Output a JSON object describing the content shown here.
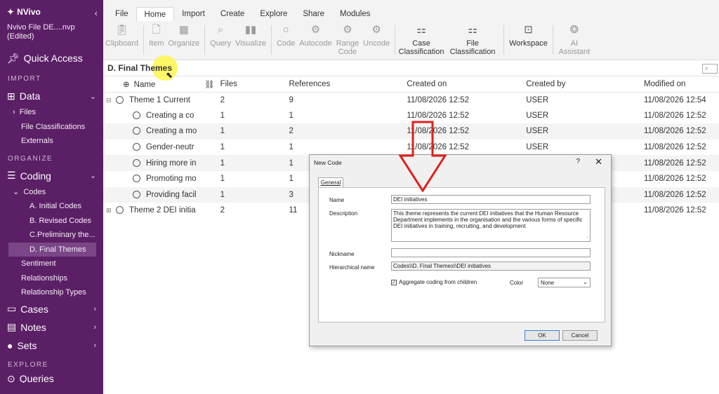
{
  "sidebar": {
    "brand": "NVivo",
    "file_name": "Nvivo File DE....nvp",
    "file_status": "(Edited)",
    "quick_access": "Quick Access",
    "sections": {
      "import": "IMPORT",
      "organize": "ORGANIZE",
      "explore": "EXPLORE"
    },
    "data": {
      "label": "Data",
      "items": [
        "Files",
        "File Classifications",
        "Externals"
      ]
    },
    "coding": {
      "label": "Coding",
      "codes_label": "Codes",
      "codes": [
        "A. Initial Codes",
        "B. Revised Codes",
        "C.Preliminary the...",
        "D. Final Themes"
      ],
      "items": [
        "Sentiment",
        "Relationships",
        "Relationship Types"
      ]
    },
    "cases": "Cases",
    "notes": "Notes",
    "sets": "Sets",
    "partial": "Queries"
  },
  "ribbon": {
    "tabs": [
      "File",
      "Home",
      "Import",
      "Create",
      "Explore",
      "Share",
      "Modules"
    ],
    "active_tab": "Home",
    "tools": {
      "clipboard": "Clipboard",
      "item": "Item",
      "organize": "Organize",
      "query": "Query",
      "visualize": "Visualize",
      "code": "Code",
      "autocode": "Autocode",
      "range_code_1": "Range",
      "range_code_2": "Code",
      "uncode": "Uncode",
      "case_class_1": "Case",
      "case_class_2": "Classification",
      "file_class_1": "File",
      "file_class_2": "Classification",
      "workspace": "Workspace",
      "ai_1": "AI",
      "ai_2": "Assistant"
    }
  },
  "main": {
    "folder_title": "D. Final Themes",
    "columns": {
      "name": "Name",
      "files": "Files",
      "references": "References",
      "created_on": "Created on",
      "created_by": "Created by",
      "modified_on": "Modified on"
    },
    "rows": [
      {
        "name": "Theme 1 Current",
        "files": "2",
        "refs": "9",
        "created_on": "11/08/2026 12:52",
        "created_by": "USER",
        "modified_on": "11/08/2026 12:54"
      },
      {
        "name": "Creating a co",
        "files": "1",
        "refs": "1",
        "created_on": "11/08/2026 12:52",
        "created_by": "USER",
        "modified_on": "11/08/2026 12:52"
      },
      {
        "name": "Creating a mo",
        "files": "1",
        "refs": "2",
        "created_on": "11/08/2026 12:52",
        "created_by": "USER",
        "modified_on": "11/08/2026 12:52"
      },
      {
        "name": "Gender-neutr",
        "files": "1",
        "refs": "1",
        "created_on": "11/08/2026 12:52",
        "created_by": "USER",
        "modified_on": "11/08/2026 12:52"
      },
      {
        "name": "Hiring more in",
        "files": "1",
        "refs": "1",
        "created_on": "",
        "created_by": "",
        "modified_on": "11/08/2026 12:52"
      },
      {
        "name": "Promoting mo",
        "files": "1",
        "refs": "1",
        "created_on": "",
        "created_by": "",
        "modified_on": "11/08/2026 12:52"
      },
      {
        "name": "Providing facil",
        "files": "1",
        "refs": "3",
        "created_on": "",
        "created_by": "",
        "modified_on": "11/08/2026 12:52"
      },
      {
        "name": "Theme 2 DEI initia",
        "files": "2",
        "refs": "11",
        "created_on": "",
        "created_by": "",
        "modified_on": "11/08/2026 12:52"
      }
    ]
  },
  "dialog": {
    "title": "New Code",
    "help": "?",
    "close": "✕",
    "tab": "General",
    "name_label": "Name",
    "name_value": "DEI initiatives",
    "description_label": "Description",
    "description_value": "This theme represents the current DEI initiatives that the Human Resource Department implements in the organisation and the various forms of specific DEI initiatives in training, recruiting, and development",
    "nickname_label": "Nickname",
    "nickname_value": "",
    "hierarchical_label": "Hierarchical name",
    "hierarchical_value": "Codes\\\\D. Final Themes\\\\DEI initiatives",
    "aggregate_label": "Aggregate coding from children",
    "color_label": "Color",
    "color_value": "None",
    "ok": "OK",
    "cancel": "Cancel"
  },
  "colors": {
    "sidebar_bg": "#5b1f66",
    "sidebar_selected": "#7b4687",
    "annotation_arrow": "#e0201c",
    "highlight": "#fff64a"
  }
}
